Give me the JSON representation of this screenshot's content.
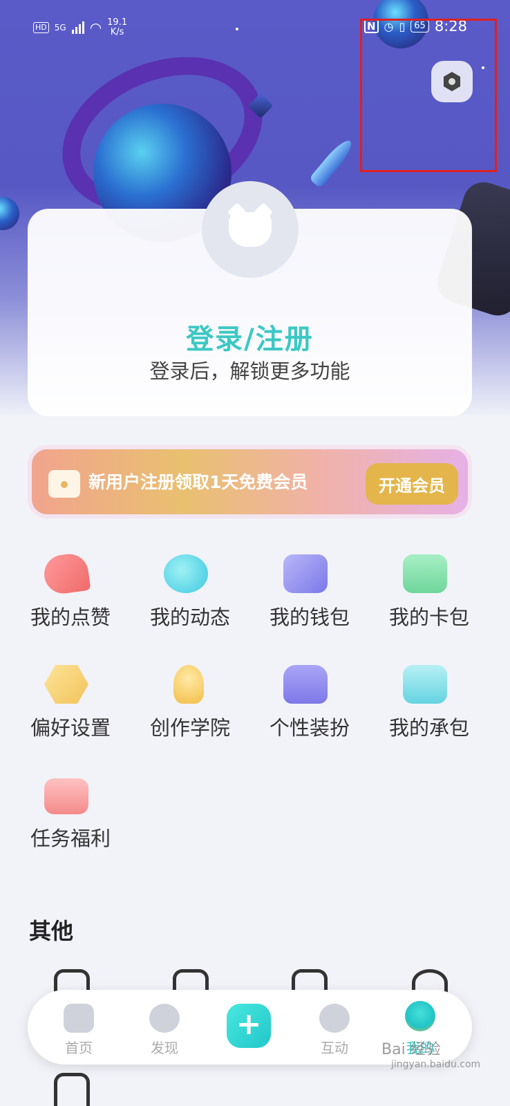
{
  "status_bar": {
    "hd": "HD",
    "signal": "5G",
    "speed": "19.1\nK/s",
    "nfc": "N",
    "battery": "65",
    "time": "8:28"
  },
  "login": {
    "title": "登录/注册",
    "subtitle": "登录后，解锁更多功能"
  },
  "vip": {
    "text": "新用户注册领取1天免费会员",
    "button": "开通会员"
  },
  "features": [
    {
      "label": "我的点赞",
      "icon": "heart-icon",
      "color": "#f47a7a"
    },
    {
      "label": "我的动态",
      "icon": "leaf-icon",
      "color": "#3cc8e0"
    },
    {
      "label": "我的钱包",
      "icon": "wallet-icon",
      "color": "#7a78e8"
    },
    {
      "label": "我的卡包",
      "icon": "card-icon",
      "color": "#6fd69a"
    },
    {
      "label": "偏好设置",
      "icon": "preference-icon",
      "color": "#f2c35a"
    },
    {
      "label": "创作学院",
      "icon": "lightbulb-icon",
      "color": "#f3be47"
    },
    {
      "label": "个性装扮",
      "icon": "shop-icon",
      "color": "#7e78e8"
    },
    {
      "label": "我的承包",
      "icon": "whale-icon",
      "color": "#64d3e0"
    },
    {
      "label": "任务福利",
      "icon": "gift-bag-icon",
      "color": "#f48a8a"
    }
  ],
  "other_section": {
    "title": "其他"
  },
  "tab_bar": {
    "home": "首页",
    "discover": "发现",
    "interact": "互动",
    "me": "我的"
  },
  "watermark": {
    "main": "Bai 经验",
    "sub": "jingyan.baidu.com"
  }
}
